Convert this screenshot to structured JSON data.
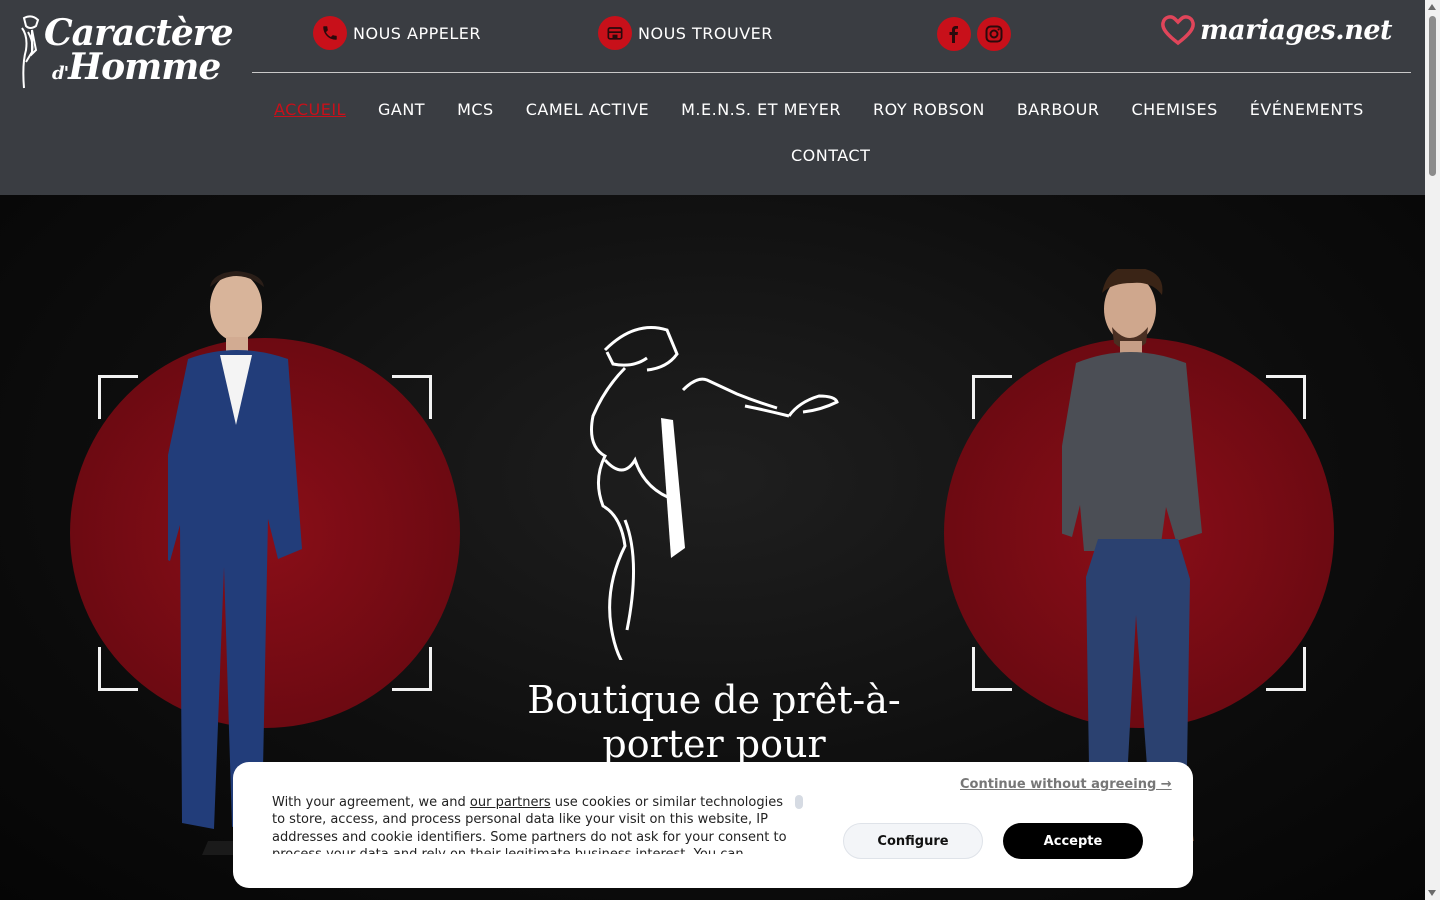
{
  "brand": {
    "logo_line1": "Caractère",
    "logo_line2a": "d'",
    "logo_line2b": "Homme"
  },
  "topbar": {
    "call_label": "NOUS APPELER",
    "find_label": "NOUS TROUVER",
    "facebook_icon": "facebook-icon",
    "instagram_icon": "instagram-icon",
    "partner_logo": "mariages.net"
  },
  "nav": {
    "items": [
      {
        "label": "ACCUEIL",
        "active": true
      },
      {
        "label": "GANT"
      },
      {
        "label": "MCS"
      },
      {
        "label": "CAMEL ACTIVE"
      },
      {
        "label": "M.E.N.S. ET MEYER"
      },
      {
        "label": "ROY ROBSON"
      },
      {
        "label": "BARBOUR"
      },
      {
        "label": "CHEMISES"
      },
      {
        "label": "ÉVÉNEMENTS"
      },
      {
        "label": "CONTACT"
      }
    ]
  },
  "hero": {
    "title": "Boutique de prêt-à-porter pour hommes"
  },
  "cookie": {
    "text_before_link": "With your agreement, we and ",
    "link_text": "our partners",
    "text_after_link": " use cookies or similar technologies to store, access, and process personal data like your visit on this website, IP addresses and cookie identifiers. Some partners do not ask for your consent to process your data and rely on their legitimate business interest. You can",
    "continue_label": "Continue without agreeing →",
    "configure_label": "Configure",
    "accept_label": "Accepte"
  },
  "colors": {
    "header_bg": "#3a3d42",
    "accent_red": "#c8101a",
    "hero_circle": "#6d0a12"
  }
}
